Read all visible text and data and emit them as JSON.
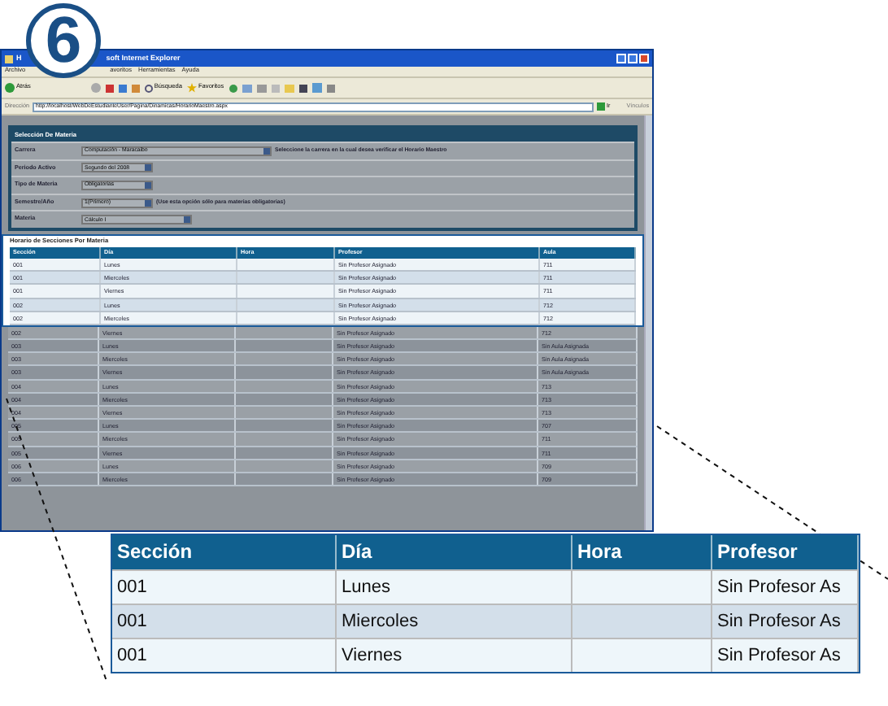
{
  "step_badge": "6",
  "window": {
    "title_start": "H",
    "title_end": "soft Internet Explorer"
  },
  "menu": [
    "Archivo",
    "avoritos",
    "Herramientas",
    "Ayuda"
  ],
  "toolbar": {
    "back": "Atrás",
    "search": "Búsqueda",
    "favorites": "Favoritos"
  },
  "address_bar": {
    "label": "Dirección",
    "url": "http://localhost/WebDeEstudianteUser/Pagina/Dinamicas/HorarioMaestro.aspx",
    "go": "Ir",
    "links": "Vínculos"
  },
  "form": {
    "title": "Selección De Materia",
    "dimmed": true,
    "fields": [
      {
        "label": "Carrera",
        "value": "Computación - Maracaibo",
        "hint": "Seleccione la carrera en la cual desea verificar el Horario Maestro"
      },
      {
        "label": "Periodo Activo",
        "value": "Segundo del 2008"
      },
      {
        "label": "Tipo de Materia",
        "value": "Obligatorias"
      },
      {
        "label": "Semestre/Año",
        "value": "1(Primero)",
        "hint": "(Use esta opción sólo para materias obligatorias)"
      },
      {
        "label": "Materia",
        "value": "Cálculo I"
      }
    ]
  },
  "schedule": {
    "title": "Horario de Secciones Por Materia",
    "columns": [
      "Sección",
      "Día",
      "Hora",
      "Profesor",
      "Aula"
    ],
    "rows": [
      {
        "cells": [
          "001",
          "Lunes",
          "",
          "Sin Profesor Asignado",
          "711"
        ],
        "dimmed": false
      },
      {
        "cells": [
          "001",
          "Miercoles",
          "",
          "Sin Profesor Asignado",
          "711"
        ],
        "dimmed": false
      },
      {
        "cells": [
          "001",
          "Viernes",
          "",
          "Sin Profesor Asignado",
          "711"
        ],
        "dimmed": false
      },
      {
        "cells": [
          "002",
          "Lunes",
          "",
          "Sin Profesor Asignado",
          "712"
        ],
        "dimmed": false
      },
      {
        "cells": [
          "002",
          "Miercoles",
          "",
          "Sin Profesor Asignado",
          "712"
        ],
        "dimmed": false
      },
      {
        "cells": [
          "002",
          "Viernes",
          "",
          "Sin Profesor Asignado",
          "712"
        ],
        "dimmed": true
      },
      {
        "cells": [
          "003",
          "Lunes",
          "",
          "Sin Profesor Asignado",
          "Sin Aula Asignada"
        ],
        "dimmed": true
      },
      {
        "cells": [
          "003",
          "Miercoles",
          "",
          "Sin Profesor Asignado",
          "Sin Aula Asignada"
        ],
        "dimmed": true
      },
      {
        "cells": [
          "003",
          "Viernes",
          "",
          "Sin Profesor Asignado",
          "Sin Aula Asignada"
        ],
        "dimmed": true
      },
      {
        "cells": [
          "004",
          "Lunes",
          "",
          "Sin Profesor Asignado",
          "713"
        ],
        "dimmed": true
      },
      {
        "cells": [
          "004",
          "Miercoles",
          "",
          "Sin Profesor Asignado",
          "713"
        ],
        "dimmed": true
      },
      {
        "cells": [
          "004",
          "Viernes",
          "",
          "Sin Profesor Asignado",
          "713"
        ],
        "dimmed": true
      },
      {
        "cells": [
          "005",
          "Lunes",
          "",
          "Sin Profesor Asignado",
          "707"
        ],
        "dimmed": true
      },
      {
        "cells": [
          "005",
          "Miercoles",
          "",
          "Sin Profesor Asignado",
          "711"
        ],
        "dimmed": true
      },
      {
        "cells": [
          "005",
          "Viernes",
          "",
          "Sin Profesor Asignado",
          "711"
        ],
        "dimmed": true
      },
      {
        "cells": [
          "006",
          "Lunes",
          "",
          "Sin Profesor Asignado",
          "709"
        ],
        "dimmed": true
      },
      {
        "cells": [
          "006",
          "Miercoles",
          "",
          "Sin Profesor Asignado",
          "709"
        ],
        "dimmed": true
      }
    ]
  },
  "zoom_inset": {
    "columns": [
      "Sección",
      "Día",
      "Hora",
      "Profesor"
    ],
    "rows": [
      [
        "001",
        "Lunes",
        "",
        "Sin Profesor As"
      ],
      [
        "001",
        "Miercoles",
        "",
        "Sin Profesor As"
      ],
      [
        "001",
        "Viernes",
        "",
        "Sin Profesor As"
      ]
    ]
  }
}
